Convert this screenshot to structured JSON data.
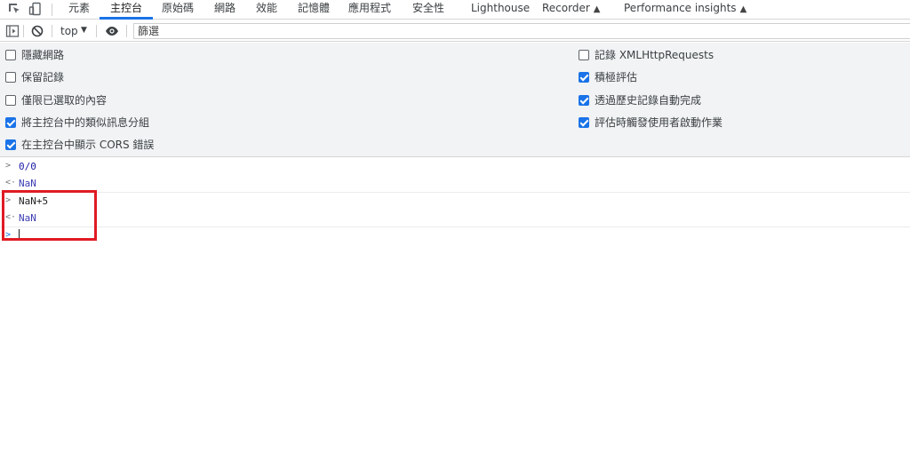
{
  "tabs": [
    {
      "label": "元素",
      "active": false
    },
    {
      "label": "主控台",
      "active": true
    },
    {
      "label": "原始碼",
      "active": false
    },
    {
      "label": "網路",
      "active": false
    },
    {
      "label": "效能",
      "active": false
    },
    {
      "label": "記憶體",
      "active": false
    },
    {
      "label": "應用程式",
      "active": false
    },
    {
      "label": "安全性",
      "active": false
    },
    {
      "label": "Lighthouse",
      "active": false
    },
    {
      "label": "Recorder",
      "active": false
    },
    {
      "label": "Performance insights",
      "active": false
    }
  ],
  "toolbar": {
    "context": "top",
    "filter_placeholder": "篩選"
  },
  "settings": {
    "left": [
      {
        "label": "隱藏網路",
        "checked": false
      },
      {
        "label": "保留記錄",
        "checked": false
      },
      {
        "label": "僅限已選取的內容",
        "checked": false
      },
      {
        "label": "將主控台中的類似訊息分組",
        "checked": true
      },
      {
        "label": "在主控台中顯示 CORS 錯誤",
        "checked": true
      }
    ],
    "right": [
      {
        "label": "記錄 XMLHttpRequests",
        "checked": false
      },
      {
        "label": "積極評估",
        "checked": true
      },
      {
        "label": "透過歷史記錄自動完成",
        "checked": true
      },
      {
        "label": "評估時觸發使用者啟動作業",
        "checked": true
      }
    ]
  },
  "console": {
    "entries": [
      {
        "input": "0/0",
        "result": "NaN"
      },
      {
        "input": "NaN+5",
        "result": "NaN"
      }
    ],
    "prompt_value": ""
  },
  "colors": {
    "accent": "#1a73e8",
    "highlight": "#e01b24"
  },
  "icons": [
    "inspect-element-icon",
    "device-toolbar-icon",
    "sidebar-toggle-icon",
    "clear-console-icon",
    "live-expression-eye-icon",
    "flask-icon"
  ]
}
